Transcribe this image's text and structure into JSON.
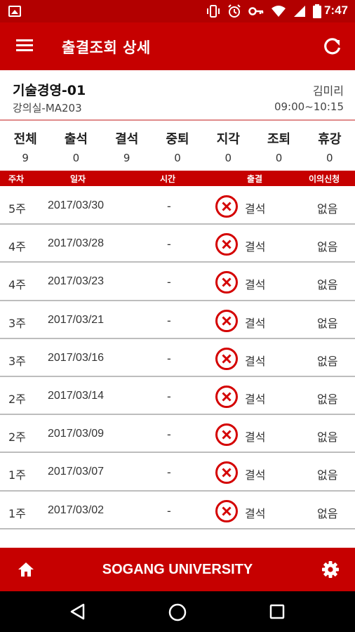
{
  "status_bar": {
    "time": "7:47",
    "icons": [
      "image-icon",
      "vibrate-icon",
      "alarm-icon",
      "key-icon",
      "wifi-icon",
      "signal-icon",
      "battery-icon"
    ]
  },
  "app_bar": {
    "title": "출결조회 상세",
    "menu_icon": "menu-icon",
    "refresh_icon": "refresh-icon"
  },
  "course": {
    "name": "기술경영-01",
    "room": "강의실-MA203",
    "professor": "김미리",
    "time": "09:00~10:15"
  },
  "summary": [
    {
      "label": "전체",
      "value": "9"
    },
    {
      "label": "출석",
      "value": "0"
    },
    {
      "label": "결석",
      "value": "9"
    },
    {
      "label": "중퇴",
      "value": "0"
    },
    {
      "label": "지각",
      "value": "0"
    },
    {
      "label": "조퇴",
      "value": "0"
    },
    {
      "label": "휴강",
      "value": "0"
    }
  ],
  "table": {
    "headers": {
      "week": "주차",
      "date": "일자",
      "time": "시간",
      "attendance": "출결",
      "appeal": "이의신청"
    },
    "rows": [
      {
        "week": "5주",
        "date": "2017/03/30",
        "time": "-",
        "status": "결석",
        "appeal": "없음"
      },
      {
        "week": "4주",
        "date": "2017/03/28",
        "time": "-",
        "status": "결석",
        "appeal": "없음"
      },
      {
        "week": "4주",
        "date": "2017/03/23",
        "time": "-",
        "status": "결석",
        "appeal": "없음"
      },
      {
        "week": "3주",
        "date": "2017/03/21",
        "time": "-",
        "status": "결석",
        "appeal": "없음"
      },
      {
        "week": "3주",
        "date": "2017/03/16",
        "time": "-",
        "status": "결석",
        "appeal": "없음"
      },
      {
        "week": "2주",
        "date": "2017/03/14",
        "time": "-",
        "status": "결석",
        "appeal": "없음"
      },
      {
        "week": "2주",
        "date": "2017/03/09",
        "time": "-",
        "status": "결석",
        "appeal": "없음"
      },
      {
        "week": "1주",
        "date": "2017/03/07",
        "time": "-",
        "status": "결석",
        "appeal": "없음"
      },
      {
        "week": "1주",
        "date": "2017/03/02",
        "time": "-",
        "status": "결석",
        "appeal": "없음"
      }
    ]
  },
  "footer": {
    "title": "SOGANG UNIVERSITY",
    "home_icon": "home-icon",
    "settings_icon": "gear-icon"
  },
  "colors": {
    "primary": "#c60000",
    "status_bar": "#b20000",
    "absent_icon": "#d40000"
  }
}
